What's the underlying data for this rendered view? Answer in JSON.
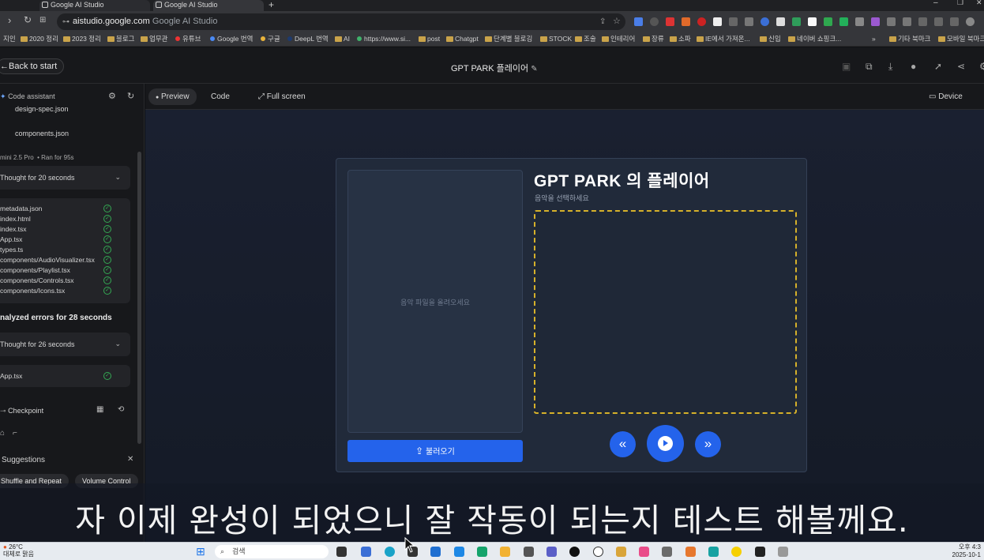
{
  "browser": {
    "tabs": [
      {
        "label": "Google AI Studio"
      },
      {
        "label": "Google AI Studio"
      }
    ],
    "url_host": "aistudio.google.com",
    "url_rest": "Google AI Studio"
  },
  "bookmarks": [
    {
      "label": "지인"
    },
    {
      "label": "2020 정리"
    },
    {
      "label": "2023 정리"
    },
    {
      "label": "블로그"
    },
    {
      "label": "업무관"
    },
    {
      "label": "유튜브"
    },
    {
      "label": "Google 번역"
    },
    {
      "label": "구글"
    },
    {
      "label": "DeepL 번역"
    },
    {
      "label": "AI"
    },
    {
      "label": "https://www.si..."
    },
    {
      "label": "post"
    },
    {
      "label": "Chatgpt"
    },
    {
      "label": "단계별 블로깅"
    },
    {
      "label": "STOCK"
    },
    {
      "label": "조술"
    },
    {
      "label": "인테리어"
    },
    {
      "label": "장류"
    },
    {
      "label": "소파"
    },
    {
      "label": "IE에서 가져온..."
    },
    {
      "label": "신입"
    },
    {
      "label": "네이버 쇼핑크..."
    },
    {
      "label": "기타 북마크"
    },
    {
      "label": "모바일 북마크"
    }
  ],
  "header": {
    "back_label": "Back to start",
    "project_title": "GPT PARK 플레이어"
  },
  "left_panel": {
    "title": "Code assistant",
    "files_top": [
      "design-spec.json",
      "components.json"
    ],
    "model_info": "mini 2.5 Pro",
    "ran_for": "Ran for 95s",
    "thought1": "Thought for 20 seconds",
    "files": [
      "metadata.json",
      "index.html",
      "index.tsx",
      "App.tsx",
      "types.ts",
      "components/AudioVisualizer.tsx",
      "components/Playlist.tsx",
      "components/Controls.tsx",
      "components/Icons.tsx"
    ],
    "analyzed": "nalyzed errors for 28 seconds",
    "thought2": "Thought for 26 seconds",
    "file_app": "App.tsx",
    "checkpoint": "Checkpoint",
    "suggestions": "Suggestions",
    "chips": [
      "Shuffle and Repeat",
      "Volume Control"
    ]
  },
  "toolbar": {
    "preview": "Preview",
    "code": "Code",
    "fullscreen": "Full screen",
    "device": "Device"
  },
  "player": {
    "title": "GPT PARK 의 플레이어",
    "subtitle": "음악을 선택하세요",
    "drop_hint": "음악 파일을 올려오세요",
    "upload_label": "불러오기"
  },
  "caption": "자 이제 완성이 되었으니 잘 작동이 되는지 테스트 해볼께요.",
  "taskbar": {
    "temp": "26°C",
    "weather_note": "대체로 맑음",
    "search_placeholder": "검색",
    "time": "오후 4:3",
    "date": "2025-10-1"
  },
  "colors": {
    "accent_blue": "#2463eb",
    "viz_border": "#d6b12a",
    "check_green": "#34a853"
  }
}
